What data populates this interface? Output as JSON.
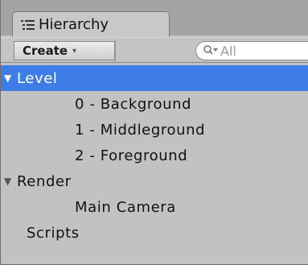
{
  "tab": {
    "title": "Hierarchy",
    "icon": "list-icon"
  },
  "toolbar": {
    "create_label": "Create",
    "create_caret": "▾",
    "search_placeholder": "All",
    "search_icon": "search-dropdown-icon"
  },
  "tree": [
    {
      "label": "Level",
      "depth": 0,
      "expanded": true,
      "has_children": true,
      "selected": true
    },
    {
      "label": "0 - Background",
      "depth": 1,
      "has_children": false,
      "selected": false
    },
    {
      "label": "1 - Middleground",
      "depth": 1,
      "has_children": false,
      "selected": false
    },
    {
      "label": "2 - Foreground",
      "depth": 1,
      "has_children": false,
      "selected": false
    },
    {
      "label": "Render",
      "depth": 0,
      "expanded": true,
      "has_children": true,
      "selected": false
    },
    {
      "label": "Main Camera",
      "depth": 1,
      "has_children": false,
      "selected": false
    },
    {
      "label": "Scripts",
      "depth": 0,
      "has_children": false,
      "selected": false
    }
  ],
  "colors": {
    "selection": "#3e7de8",
    "panel_background": "#c2c2c2",
    "tab_bar_background": "#a4a4a4"
  }
}
